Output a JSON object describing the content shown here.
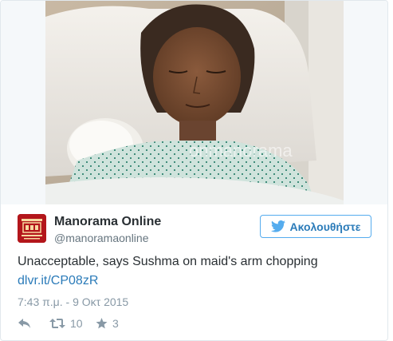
{
  "photo": {
    "watermark": "onmanorama",
    "alt_icon": "photo"
  },
  "account": {
    "display_name": "Manorama Online",
    "screen_name": "@manoramaonline",
    "avatar_icon": "manorama-logo-icon",
    "avatar_color": "#b3161b"
  },
  "follow": {
    "label": "Ακολουθήστε",
    "icon": "twitter-bird-icon",
    "accent": "#55acee"
  },
  "tweet": {
    "text": "Unacceptable, says Sushma on maid's arm chopping",
    "link": "dlvr.it/CP08zR",
    "timestamp": "7:43 π.μ. - 9 Οκτ 2015"
  },
  "actions": {
    "reply_icon": "reply-icon",
    "retweet_icon": "retweet-icon",
    "retweet_count": "10",
    "like_icon": "star-icon",
    "like_count": "3"
  }
}
